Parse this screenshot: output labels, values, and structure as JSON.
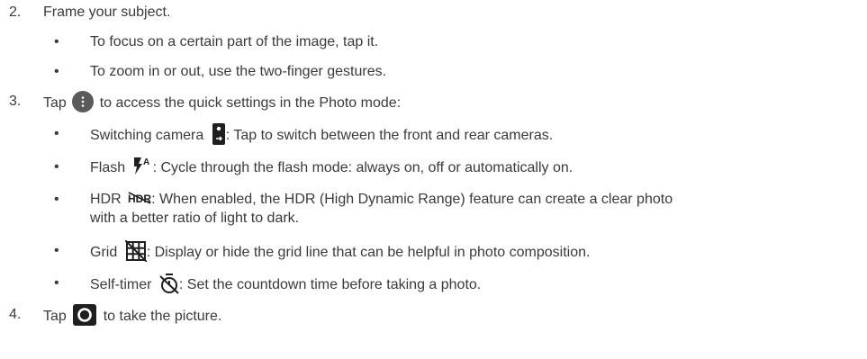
{
  "step2": {
    "number": "2.",
    "text": "Frame your subject.",
    "bullets": [
      "To focus on a certain part of the image, tap it.",
      "To zoom in or out, use the two-finger gestures."
    ]
  },
  "step3": {
    "number": "3.",
    "before_icon": "Tap",
    "after_icon": "to access the quick settings in the Photo mode:",
    "icon": "more-options-icon",
    "items": [
      {
        "label": "Switching camera",
        "icon": "switch-camera-icon",
        "desc": ": Tap to switch between the front and rear cameras."
      },
      {
        "label": "Flash",
        "icon": "flash-auto-icon",
        "desc": ": Cycle through the flash mode: always on, off or automatically on."
      },
      {
        "label": "HDR",
        "icon": "hdr-off-icon",
        "desc": ": When enabled, the HDR (High Dynamic Range) feature can create a clear photo",
        "desc_cont": "with a better ratio of light to dark."
      },
      {
        "label": "Grid",
        "icon": "grid-off-icon",
        "desc": ": Display or hide the grid line that can be helpful in photo composition."
      },
      {
        "label": "Self-timer",
        "icon": "timer-off-icon",
        "desc": ": Set the countdown time before taking a photo."
      }
    ]
  },
  "step4": {
    "number": "4.",
    "before_icon": "Tap",
    "after_icon": "to take the picture.",
    "icon": "shutter-icon"
  },
  "bullet_char": "•",
  "colors": {
    "text": "#3a3a3a",
    "icon": "#1f1f1f",
    "more_button": "#5a5a5a"
  }
}
